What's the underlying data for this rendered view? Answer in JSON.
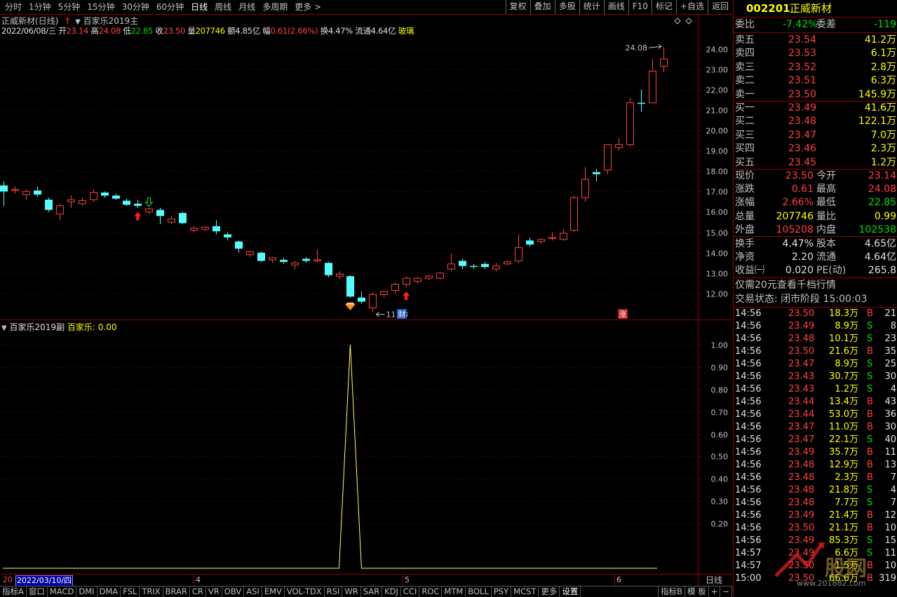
{
  "toolbar": {
    "periods": [
      {
        "label": "分时",
        "active": false
      },
      {
        "label": "1分钟",
        "active": false
      },
      {
        "label": "5分钟",
        "active": false
      },
      {
        "label": "15分钟",
        "active": false
      },
      {
        "label": "30分钟",
        "active": false
      },
      {
        "label": "60分钟",
        "active": false
      },
      {
        "label": "日线",
        "active": true
      },
      {
        "label": "周线",
        "active": false
      },
      {
        "label": "月线",
        "active": false
      },
      {
        "label": "多周期",
        "active": false
      },
      {
        "label": "更多 >",
        "active": false
      }
    ],
    "tools": [
      "复权",
      "叠加",
      "多股",
      "统计",
      "画线",
      "F10",
      "标记",
      "+自选",
      "返回"
    ]
  },
  "header": {
    "stock_title": "正威新材(日线)",
    "indicator_main": "百家乐2019主",
    "date": "2022/06/08/三",
    "open_label": "开",
    "open": "23.14",
    "high_label": "高",
    "high": "24.08",
    "low_label": "低",
    "low": "22.85",
    "close_label": "收",
    "close": "23.50",
    "vol_label": "量",
    "vol": "207746",
    "amt_label": "额",
    "amt": "4.85亿",
    "chg_label": "幅",
    "chg": "0.61(2.66%)",
    "turn_label": "换",
    "turn": "4.47%",
    "float_label": "流通",
    "float": "4.64亿",
    "concept": "玻璃"
  },
  "chart_data": [
    {
      "type": "candlestick",
      "title": "正威新材(日线)",
      "ylim": [
        11.0,
        24.5
      ],
      "yticks": [
        "24.00",
        "23.00",
        "22.00",
        "21.00",
        "20.00",
        "19.00",
        "18.00",
        "17.00",
        "16.00",
        "15.00",
        "14.00",
        "13.00",
        "12.00"
      ],
      "candles": [
        [
          17.3,
          17.0,
          17.5,
          16.3
        ],
        [
          17.05,
          17.1,
          17.25,
          16.9
        ],
        [
          16.85,
          17.0,
          17.1,
          16.6
        ],
        [
          17.05,
          16.85,
          17.25,
          16.75
        ],
        [
          16.6,
          16.1,
          16.7,
          16.0
        ],
        [
          15.9,
          16.3,
          16.4,
          15.6
        ],
        [
          16.5,
          16.6,
          16.8,
          16.2
        ],
        [
          16.4,
          16.55,
          16.7,
          16.3
        ],
        [
          16.6,
          16.95,
          17.1,
          16.5
        ],
        [
          16.95,
          16.8,
          17.0,
          16.7
        ],
        [
          16.8,
          16.65,
          16.9,
          16.6
        ],
        [
          16.55,
          16.35,
          16.65,
          16.3
        ],
        [
          16.4,
          16.3,
          16.6,
          16.2
        ],
        [
          16.0,
          16.15,
          16.2,
          15.9
        ],
        [
          16.1,
          15.8,
          16.2,
          15.4
        ],
        [
          15.5,
          15.65,
          15.8,
          15.4
        ],
        [
          15.95,
          15.45,
          16.0,
          15.4
        ],
        [
          15.1,
          15.2,
          15.3,
          15.0
        ],
        [
          15.15,
          15.25,
          15.3,
          15.05
        ],
        [
          15.3,
          15.05,
          15.6,
          14.9
        ],
        [
          14.9,
          14.75,
          15.0,
          14.6
        ],
        [
          14.55,
          14.2,
          14.6,
          14.0
        ],
        [
          13.9,
          14.05,
          14.1,
          13.8
        ],
        [
          14.0,
          13.6,
          14.05,
          13.55
        ],
        [
          13.65,
          13.75,
          13.8,
          13.5
        ],
        [
          13.65,
          13.55,
          13.75,
          13.45
        ],
        [
          13.4,
          13.5,
          13.6,
          13.2
        ],
        [
          13.7,
          13.6,
          13.8,
          13.5
        ],
        [
          13.6,
          13.65,
          14.15,
          13.55
        ],
        [
          13.5,
          12.9,
          13.55,
          12.8
        ],
        [
          12.85,
          12.95,
          13.1,
          12.7
        ],
        [
          12.85,
          11.85,
          12.9,
          11.8
        ],
        [
          11.8,
          11.6,
          12.1,
          11.5
        ],
        [
          11.3,
          11.95,
          12.05,
          11.08
        ],
        [
          11.95,
          12.1,
          12.15,
          11.8
        ],
        [
          12.15,
          12.45,
          12.55,
          12.0
        ],
        [
          12.45,
          12.75,
          12.85,
          12.3
        ],
        [
          12.6,
          12.75,
          12.8,
          12.5
        ],
        [
          12.75,
          12.85,
          12.9,
          12.65
        ],
        [
          12.75,
          13.0,
          13.05,
          12.7
        ],
        [
          13.2,
          13.45,
          13.95,
          13.1
        ],
        [
          13.6,
          13.35,
          13.7,
          13.2
        ],
        [
          13.35,
          13.3,
          13.45,
          13.2
        ],
        [
          13.45,
          13.3,
          13.55,
          13.2
        ],
        [
          13.2,
          13.35,
          13.5,
          13.1
        ],
        [
          13.45,
          13.55,
          13.6,
          13.4
        ],
        [
          13.6,
          14.25,
          14.9,
          13.5
        ],
        [
          14.6,
          14.4,
          14.75,
          14.3
        ],
        [
          14.55,
          14.65,
          14.7,
          14.45
        ],
        [
          14.7,
          14.75,
          15.0,
          14.6
        ],
        [
          14.65,
          14.95,
          15.15,
          14.6
        ],
        [
          15.1,
          16.7,
          16.8,
          15.0
        ],
        [
          16.7,
          17.6,
          18.2,
          16.5
        ],
        [
          17.95,
          17.85,
          18.1,
          17.5
        ],
        [
          18.05,
          19.3,
          19.3,
          17.85
        ],
        [
          19.15,
          19.3,
          19.6,
          19.0
        ],
        [
          19.3,
          21.35,
          21.6,
          19.2
        ],
        [
          21.35,
          21.3,
          22.0,
          20.9
        ],
        [
          21.35,
          22.9,
          23.5,
          21.35
        ],
        [
          23.14,
          23.5,
          24.08,
          22.85
        ]
      ],
      "signals": {
        "buy": [
          12,
          36
        ],
        "sell": [
          13
        ],
        "bottom": [
          31
        ],
        "low_label_index": 33,
        "high_label_index": 59
      },
      "max_label": "24.08",
      "min_label": "11.08",
      "markers": [
        "财",
        "涨"
      ]
    },
    {
      "type": "line",
      "title": "百家乐2019副",
      "series": [
        {
          "name": "百家乐",
          "values": [
            0,
            0,
            0,
            0,
            0,
            0,
            0,
            0,
            0,
            0,
            0,
            0,
            0,
            0,
            0,
            0,
            0,
            0,
            0,
            0,
            0,
            0,
            0,
            0,
            0,
            0,
            0,
            0,
            0,
            0,
            0,
            1,
            0,
            0,
            0,
            0,
            0,
            0,
            0,
            0,
            0,
            0,
            0,
            0,
            0,
            0,
            0,
            0,
            0,
            0,
            0,
            0,
            0,
            0,
            0,
            0,
            0,
            0,
            0,
            0
          ]
        }
      ],
      "current_value": "0.00",
      "ylim": [
        0,
        1.05
      ],
      "yticks": [
        "1.00",
        "0.90",
        "0.80",
        "0.70",
        "0.60",
        "0.50",
        "0.40",
        "0.30",
        "0.20"
      ]
    }
  ],
  "datebar": {
    "prefix": "20",
    "cursor_date": "2022/03/10/四",
    "months": [
      "4",
      "5",
      "6"
    ],
    "period": "日线"
  },
  "tabs": [
    {
      "label": "指标A",
      "active": false
    },
    {
      "label": "窗口",
      "active": false
    },
    {
      "label": "MACD",
      "active": false
    },
    {
      "label": "DMI",
      "active": false
    },
    {
      "label": "DMA",
      "active": false
    },
    {
      "label": "FSL",
      "active": false
    },
    {
      "label": "TRIX",
      "active": false
    },
    {
      "label": "BRAR",
      "active": false
    },
    {
      "label": "CR",
      "active": false
    },
    {
      "label": "VR",
      "active": false
    },
    {
      "label": "OBV",
      "active": false
    },
    {
      "label": "ASI",
      "active": false
    },
    {
      "label": "EMV",
      "active": false
    },
    {
      "label": "VOL-TDX",
      "active": false
    },
    {
      "label": "RSI",
      "active": false
    },
    {
      "label": "WR",
      "active": false
    },
    {
      "label": "SAR",
      "active": false
    },
    {
      "label": "KDJ",
      "active": false
    },
    {
      "label": "CCI",
      "active": false
    },
    {
      "label": "ROC",
      "active": false
    },
    {
      "label": "MTM",
      "active": false
    },
    {
      "label": "BOLL",
      "active": false
    },
    {
      "label": "PSY",
      "active": false
    },
    {
      "label": "MCST",
      "active": false
    },
    {
      "label": "更多",
      "active": false
    },
    {
      "label": "设置",
      "active": true
    }
  ],
  "tabs_right": [
    "指标B",
    "模 板",
    "+",
    "−"
  ],
  "quote": {
    "code": "002201",
    "name": "正威新材",
    "wb_label": "委比",
    "wb": "-7.42%",
    "wc_label": "委差",
    "wc": "-119",
    "asks": [
      {
        "label": "卖五",
        "price": "23.54",
        "vol": "41.2万"
      },
      {
        "label": "卖四",
        "price": "23.53",
        "vol": "6.1万"
      },
      {
        "label": "卖三",
        "price": "23.52",
        "vol": "2.8万"
      },
      {
        "label": "卖二",
        "price": "23.51",
        "vol": "6.3万"
      },
      {
        "label": "卖一",
        "price": "23.50",
        "vol": "145.9万"
      }
    ],
    "bids": [
      {
        "label": "买一",
        "price": "23.49",
        "vol": "41.6万"
      },
      {
        "label": "买二",
        "price": "23.48",
        "vol": "122.1万"
      },
      {
        "label": "买三",
        "price": "23.47",
        "vol": "7.0万"
      },
      {
        "label": "买四",
        "price": "23.46",
        "vol": "2.3万"
      },
      {
        "label": "买五",
        "price": "23.45",
        "vol": "1.2万"
      }
    ],
    "stats": [
      [
        {
          "l": "现价",
          "v": "23.50",
          "c": "red"
        },
        {
          "l": "今开",
          "v": "23.14",
          "c": "red"
        }
      ],
      [
        {
          "l": "涨跌",
          "v": "0.61",
          "c": "red"
        },
        {
          "l": "最高",
          "v": "24.08",
          "c": "red"
        }
      ],
      [
        {
          "l": "涨幅",
          "v": "2.66%",
          "c": "red"
        },
        {
          "l": "最低",
          "v": "22.85",
          "c": "green"
        }
      ],
      [
        {
          "l": "总量",
          "v": "207746",
          "c": "yellow"
        },
        {
          "l": "量比",
          "v": "0.99",
          "c": "yellow"
        }
      ],
      [
        {
          "l": "外盘",
          "v": "105208",
          "c": "red"
        },
        {
          "l": "内盘",
          "v": "102538",
          "c": "green"
        }
      ]
    ],
    "stats2": [
      [
        {
          "l": "换手",
          "v": "4.47%",
          "c": "white"
        },
        {
          "l": "股本",
          "v": "4.65亿",
          "c": "white"
        }
      ],
      [
        {
          "l": "净资",
          "v": "2.20",
          "c": "white"
        },
        {
          "l": "流通",
          "v": "4.64亿",
          "c": "white"
        }
      ],
      [
        {
          "l": "收益㈠",
          "v": "0.020",
          "c": "white"
        },
        {
          "l": "PE(动)",
          "v": "265.8",
          "c": "white"
        }
      ]
    ],
    "promo": "仅需20元查看千档行情",
    "status": "交易状态: 闭市阶段 15:00:03"
  },
  "ticks": [
    {
      "t": "14:56",
      "p": "23.50",
      "v": "18.3万",
      "d": "B",
      "n": "21"
    },
    {
      "t": "14:56",
      "p": "23.49",
      "v": "8.9万",
      "d": "S",
      "n": "8"
    },
    {
      "t": "14:56",
      "p": "23.48",
      "v": "10.1万",
      "d": "S",
      "n": "23"
    },
    {
      "t": "14:56",
      "p": "23.50",
      "v": "21.6万",
      "d": "B",
      "n": "35"
    },
    {
      "t": "14:56",
      "p": "23.47",
      "v": "8.9万",
      "d": "S",
      "n": "25"
    },
    {
      "t": "14:56",
      "p": "23.43",
      "v": "30.7万",
      "d": "S",
      "n": "30"
    },
    {
      "t": "14:56",
      "p": "23.43",
      "v": "1.2万",
      "d": "S",
      "n": "4"
    },
    {
      "t": "14:56",
      "p": "23.44",
      "v": "13.4万",
      "d": "B",
      "n": "43"
    },
    {
      "t": "14:56",
      "p": "23.44",
      "v": "53.0万",
      "d": "B",
      "n": "36"
    },
    {
      "t": "14:56",
      "p": "23.47",
      "v": "11.0万",
      "d": "B",
      "n": "30"
    },
    {
      "t": "14:56",
      "p": "23.47",
      "v": "22.1万",
      "d": "S",
      "n": "40"
    },
    {
      "t": "14:56",
      "p": "23.49",
      "v": "35.7万",
      "d": "B",
      "n": "11"
    },
    {
      "t": "14:56",
      "p": "23.48",
      "v": "12.9万",
      "d": "B",
      "n": "13"
    },
    {
      "t": "14:56",
      "p": "23.48",
      "v": "2.3万",
      "d": "B",
      "n": "7"
    },
    {
      "t": "14:56",
      "p": "23.48",
      "v": "21.8万",
      "d": "S",
      "n": "4"
    },
    {
      "t": "14:56",
      "p": "23.48",
      "v": "7.7万",
      "d": "S",
      "n": "7"
    },
    {
      "t": "14:56",
      "p": "23.49",
      "v": "21.4万",
      "d": "B",
      "n": "12"
    },
    {
      "t": "14:56",
      "p": "23.50",
      "v": "21.1万",
      "d": "B",
      "n": "10"
    },
    {
      "t": "14:56",
      "p": "23.49",
      "v": "85.3万",
      "d": "S",
      "n": "15"
    },
    {
      "t": "14:57",
      "p": "23.49",
      "v": "6.6万",
      "d": "S",
      "n": "11"
    },
    {
      "t": "14:57",
      "p": "23.50",
      "v": "1.5万",
      "d": "B",
      "n": "10"
    },
    {
      "t": "15:00",
      "p": "23.50",
      "v": "66.6万",
      "d": "B",
      "n": "319"
    }
  ],
  "watermark": {
    "brand": "股网",
    "url": "www.201882.com"
  },
  "colors": {
    "up": "#ff4040",
    "down": "#54ffff",
    "grid": "#8b0000",
    "axis": "#c0c0c0",
    "line": "#ffff60"
  }
}
